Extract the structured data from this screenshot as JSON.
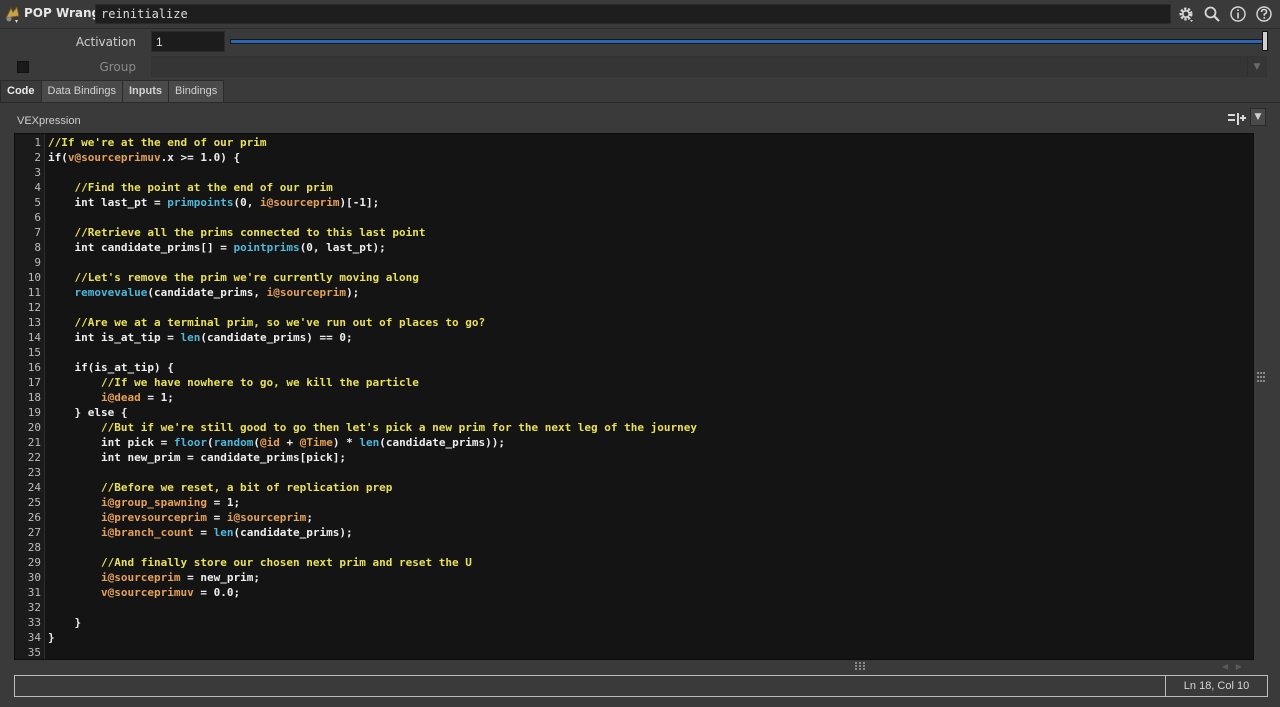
{
  "header": {
    "node_type": "POP Wrangle",
    "node_name": "reinitialize",
    "icons": [
      "gear-icon",
      "search-icon",
      "info-icon",
      "help-icon"
    ]
  },
  "parms": {
    "activation_label": "Activation",
    "activation_value": "1",
    "activation_slider_fraction": 1.0,
    "group_label": "Group",
    "group_value": ""
  },
  "tabs": [
    "Code",
    "Data Bindings",
    "Inputs",
    "Bindings"
  ],
  "editor": {
    "label": "VEXpression",
    "lines": [
      [
        [
          "c",
          "//If we're at the end of our prim"
        ]
      ],
      [
        [
          "k",
          "if"
        ],
        [
          "n",
          "("
        ],
        [
          "a",
          "v@sourceprimuv"
        ],
        [
          "n",
          ".x >= 1.0) {"
        ]
      ],
      [],
      [
        [
          "n",
          "    "
        ],
        [
          "c",
          "//Find the point at the end of our prim"
        ]
      ],
      [
        [
          "n",
          "    "
        ],
        [
          "k",
          "int"
        ],
        [
          "n",
          " last_pt = "
        ],
        [
          "f",
          "primpoints"
        ],
        [
          "n",
          "(0, "
        ],
        [
          "a",
          "i@sourceprim"
        ],
        [
          "n",
          ")[-1];"
        ]
      ],
      [],
      [
        [
          "n",
          "    "
        ],
        [
          "c",
          "//Retrieve all the prims connected to this last point"
        ]
      ],
      [
        [
          "n",
          "    "
        ],
        [
          "k",
          "int"
        ],
        [
          "n",
          " candidate_prims[] = "
        ],
        [
          "f",
          "pointprims"
        ],
        [
          "n",
          "(0, last_pt);"
        ]
      ],
      [],
      [
        [
          "n",
          "    "
        ],
        [
          "c",
          "//Let's remove the prim we're currently moving along"
        ]
      ],
      [
        [
          "n",
          "    "
        ],
        [
          "f",
          "removevalue"
        ],
        [
          "n",
          "(candidate_prims, "
        ],
        [
          "a",
          "i@sourceprim"
        ],
        [
          "n",
          ");"
        ]
      ],
      [],
      [
        [
          "n",
          "    "
        ],
        [
          "c",
          "//Are we at a terminal prim, so we've run out of places to go?"
        ]
      ],
      [
        [
          "n",
          "    "
        ],
        [
          "k",
          "int"
        ],
        [
          "n",
          " is_at_tip = "
        ],
        [
          "f",
          "len"
        ],
        [
          "n",
          "(candidate_prims) == 0;"
        ]
      ],
      [],
      [
        [
          "n",
          "    "
        ],
        [
          "k",
          "if"
        ],
        [
          "n",
          "(is_at_tip) {"
        ]
      ],
      [
        [
          "n",
          "        "
        ],
        [
          "c",
          "//If we have nowhere to go, we kill the particle"
        ]
      ],
      [
        [
          "n",
          "        "
        ],
        [
          "a",
          "i@dead"
        ],
        [
          "n",
          " = 1;"
        ]
      ],
      [
        [
          "n",
          "    } "
        ],
        [
          "k",
          "else"
        ],
        [
          "n",
          " {"
        ]
      ],
      [
        [
          "n",
          "        "
        ],
        [
          "c",
          "//But if we're still good to go then let's pick a new prim for the next leg of the journey"
        ]
      ],
      [
        [
          "n",
          "        "
        ],
        [
          "k",
          "int"
        ],
        [
          "n",
          " pick = "
        ],
        [
          "f",
          "floor"
        ],
        [
          "n",
          "("
        ],
        [
          "f",
          "random"
        ],
        [
          "n",
          "("
        ],
        [
          "a",
          "@id"
        ],
        [
          "n",
          " + "
        ],
        [
          "a",
          "@Time"
        ],
        [
          "n",
          ") * "
        ],
        [
          "f",
          "len"
        ],
        [
          "n",
          "(candidate_prims));"
        ]
      ],
      [
        [
          "n",
          "        "
        ],
        [
          "k",
          "int"
        ],
        [
          "n",
          " new_prim = candidate_prims[pick];"
        ]
      ],
      [],
      [
        [
          "n",
          "        "
        ],
        [
          "c",
          "//Before we reset, a bit of replication prep"
        ]
      ],
      [
        [
          "n",
          "        "
        ],
        [
          "a",
          "i@group_spawning"
        ],
        [
          "n",
          " = 1;"
        ]
      ],
      [
        [
          "n",
          "        "
        ],
        [
          "a",
          "i@prevsourceprim"
        ],
        [
          "n",
          " = "
        ],
        [
          "a",
          "i@sourceprim"
        ],
        [
          "n",
          ";"
        ]
      ],
      [
        [
          "n",
          "        "
        ],
        [
          "a",
          "i@branch_count"
        ],
        [
          "n",
          " = "
        ],
        [
          "f",
          "len"
        ],
        [
          "n",
          "(candidate_prims);"
        ]
      ],
      [],
      [
        [
          "n",
          "        "
        ],
        [
          "c",
          "//And finally store our chosen next prim and reset the U"
        ]
      ],
      [
        [
          "n",
          "        "
        ],
        [
          "a",
          "i@sourceprim"
        ],
        [
          "n",
          " = new_prim;"
        ]
      ],
      [
        [
          "n",
          "        "
        ],
        [
          "a",
          "v@sourceprimuv"
        ],
        [
          "n",
          " = 0.0;"
        ]
      ],
      [],
      [
        [
          "n",
          "    }"
        ]
      ],
      [
        [
          "n",
          "}"
        ]
      ],
      []
    ]
  },
  "status": {
    "message": "",
    "cursor_pos": "Ln 18, Col 10"
  },
  "colors": {
    "comment": "#e9e05a",
    "keyword": "#eeeeee",
    "function": "#4fb8d8",
    "attribute": "#e5a05a",
    "slider": "#2a66b3"
  }
}
